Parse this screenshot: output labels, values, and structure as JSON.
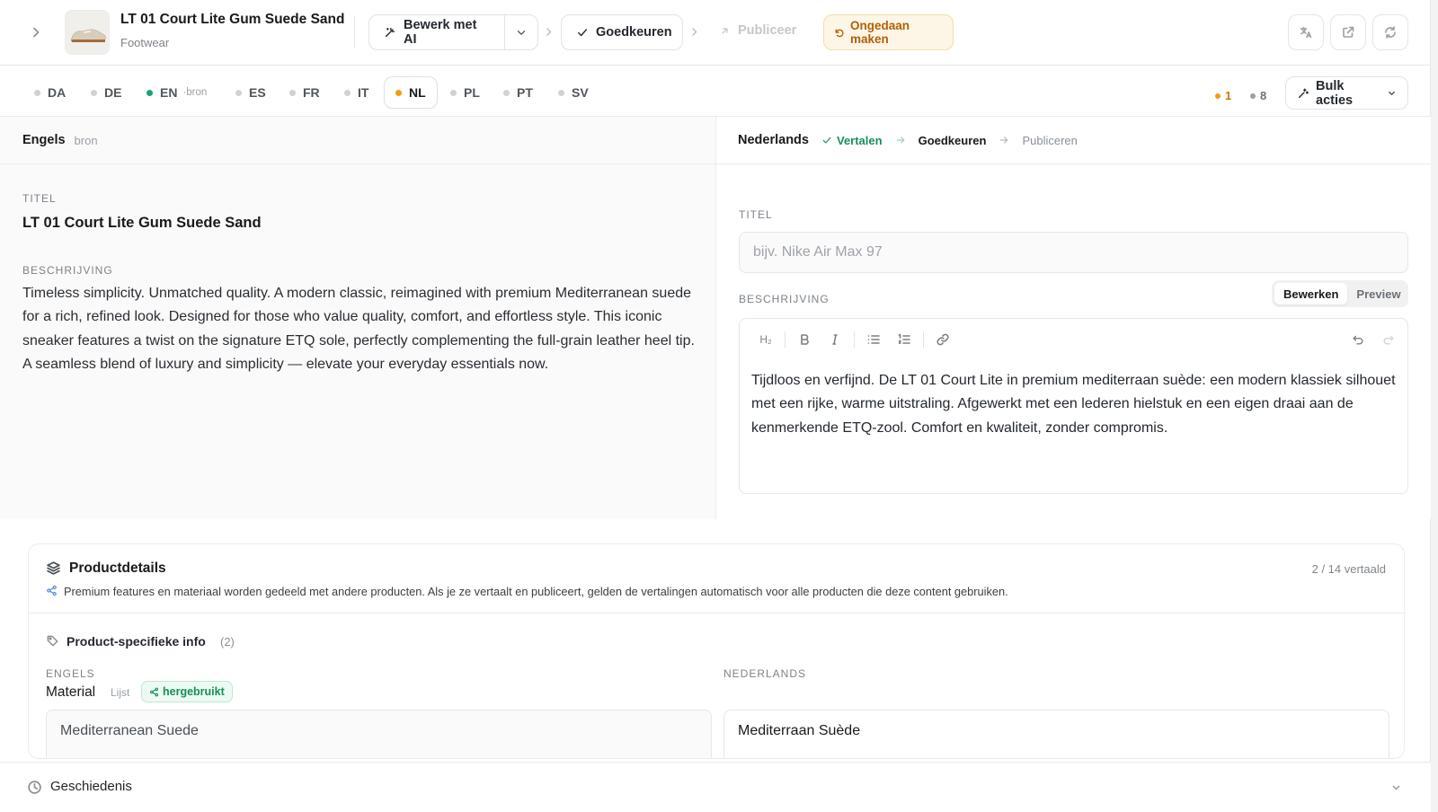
{
  "product": {
    "title": "LT 01 Court Lite Gum Suede Sand",
    "category": "Footwear"
  },
  "toolbar": {
    "edit_ai_label": "Bewerk met AI",
    "approve_label": "Goedkeuren",
    "publish_label": "Publiceer",
    "undo_label": "Ongedaan maken",
    "icons": [
      "chevron-right-icon",
      "magic-wand-icon",
      "chevron-down-icon",
      "check-icon",
      "arrow-up-right-icon",
      "undo-icon",
      "translate-icon",
      "external-link-icon",
      "refresh-icon"
    ]
  },
  "languages": [
    {
      "code": "DA",
      "status": "none"
    },
    {
      "code": "DE",
      "status": "none"
    },
    {
      "code": "EN",
      "status": "source",
      "tag": "·bron"
    },
    {
      "code": "ES",
      "status": "none"
    },
    {
      "code": "FR",
      "status": "none"
    },
    {
      "code": "IT",
      "status": "none"
    },
    {
      "code": "NL",
      "status": "pending",
      "active": true
    },
    {
      "code": "PL",
      "status": "none"
    },
    {
      "code": "PT",
      "status": "none"
    },
    {
      "code": "SV",
      "status": "none"
    }
  ],
  "counts": {
    "pending": "1",
    "empty": "8"
  },
  "bulk_label": "Bulk acties",
  "source": {
    "heading": "Engels",
    "sub": "bron",
    "title_label": "TITEL",
    "title_value": "LT 01 Court Lite Gum Suede Sand",
    "desc_label": "BESCHRIJVING",
    "desc_value": "Timeless simplicity. Unmatched quality. A modern classic, reimagined with premium Mediterranean suede for a rich, refined look. Designed for those who value quality, comfort, and effortless style. This iconic sneaker features a twist on the signature ETQ sole, perfectly complementing the full-grain leather heel tip. A seamless blend of luxury and simplicity — elevate your everyday essentials now."
  },
  "target": {
    "heading": "Nederlands",
    "steps": [
      {
        "label": "Vertalen",
        "state": "done"
      },
      {
        "label": "Goedkeuren",
        "state": "current"
      },
      {
        "label": "Publiceren",
        "state": "todo"
      }
    ],
    "title_label": "TITEL",
    "title_placeholder": "bijv. Nike Air Max 97",
    "desc_label": "BESCHRIJVING",
    "mode_edit": "Bewerken",
    "mode_preview": "Preview",
    "editor_heading_btn": "H₂",
    "desc_value": "Tijdloos en verfijnd. De LT 01 Court Lite in premium mediterraan suède: een modern klassiek silhouet met een rijke, warme uitstraling. Afgewerkt met een lederen hielstuk en een eigen draai aan de kenmerkende ETQ-zool. Comfort en kwaliteit, zonder compromis."
  },
  "details": {
    "title": "Productdetails",
    "progress": "2 / 14 vertaald",
    "note": "Premium features en materiaal worden gedeeld met andere producten. Als je ze vertaalt en publiceert, gelden de vertalingen automatisch voor alle producten die deze content gebruiken.",
    "specific_label": "Product-specifieke info",
    "specific_count": "(2)",
    "col_source": "ENGELS",
    "col_target": "NEDERLANDS",
    "field_name": "Material",
    "field_type": "Lijst",
    "reused_label": "hergebruikt",
    "source_value": "Mediterranean Suede",
    "target_value": "Mediterraan Suède"
  },
  "history_label": "Geschiedenis",
  "colors": {
    "accent_green": "#17a673",
    "accent_orange": "#f19c14",
    "undo_bg": "#fdf6e6"
  }
}
